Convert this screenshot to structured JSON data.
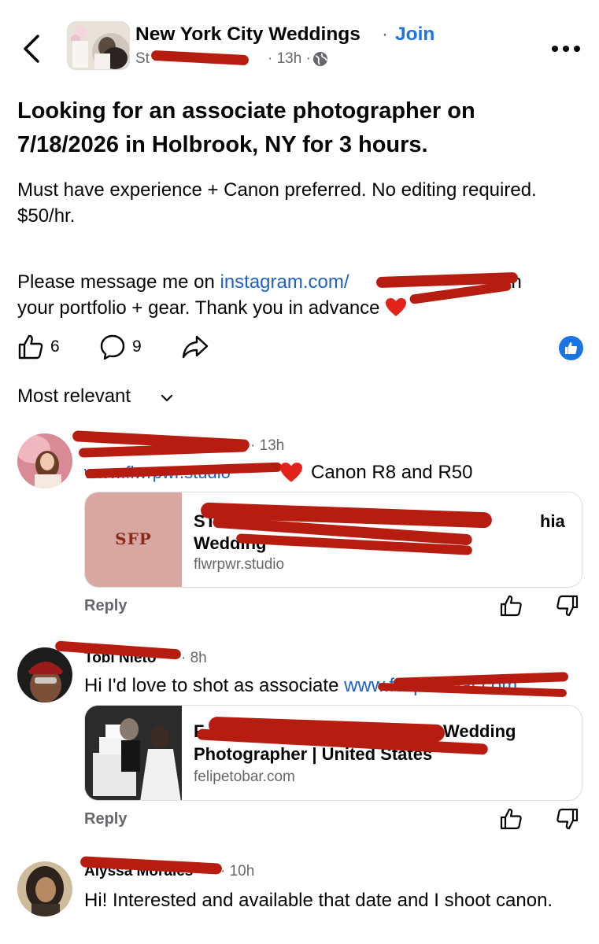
{
  "header": {
    "group_name": "New York City Weddings",
    "separator": "·",
    "join_label": "Join",
    "author": "St",
    "time": "· 13h ·"
  },
  "post": {
    "title": "Looking for an associate photographer on 7/18/2026 in Holbrook, NY for 3 hours.",
    "body_1": "Must have experience + Canon preferred. No editing required. $50/hr.",
    "body_2_prefix": "Please message me on ",
    "body_2_link": "instagram.com/",
    "body_2_suffix": " with",
    "body_2_line2": "your portfolio + gear. Thank you in advance",
    "likes": "6",
    "comments": "9"
  },
  "sort": {
    "label": "Most relevant"
  },
  "comments": [
    {
      "time": "· 13h",
      "link": "www.flwrpwr.studio",
      "text": "Canon R8 and R50",
      "card": {
        "logo": "SFP",
        "title_a": "ST",
        "title_a_tail": "hia",
        "title_b": "Wedding",
        "domain": "flwrpwr.studio"
      },
      "reply_label": "Reply"
    },
    {
      "name": "Tobi Nieto",
      "time": "· 8h",
      "text": "Hi I'd love to shot as associate ",
      "link": "www.felipetobar.com",
      "card": {
        "title_a": "F",
        "title_a_tail": "Wedding",
        "title_b": "Photographer | United States",
        "domain": "felipetobar.com"
      },
      "reply_label": "Reply"
    },
    {
      "name": "Alyssa Morales",
      "time": "· 10h",
      "text": "Hi! Interested and available that date and I shoot canon."
    }
  ],
  "colors": {
    "link": "#1b62c8",
    "join": "#1b74e4",
    "redaction": "#b71c10",
    "muted": "#65676b"
  }
}
